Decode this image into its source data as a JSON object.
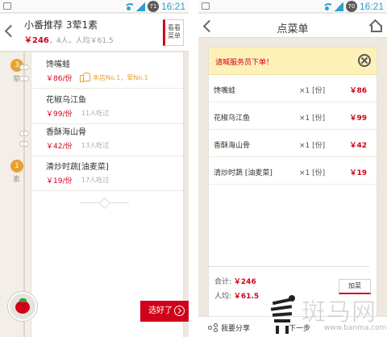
{
  "left_screen": {
    "status_bar": {
      "time": "16:21",
      "battery_level": "71"
    },
    "header": {
      "title": "小番推荐  3荤1素",
      "price": "￥246",
      "sub_rest": "，4人，人均￥61.5",
      "view_button_line1": "看看",
      "view_button_line2": "菜单"
    },
    "groups": [
      {
        "count": "3",
        "word": "荤"
      },
      {
        "count": "1",
        "word": "素"
      }
    ],
    "dishes": [
      {
        "name": "馋嘴蛙",
        "price": "￥86/份",
        "meta": "本店No.1，荤No.1"
      },
      {
        "name": "花椒乌江鱼",
        "price": "￥99/份",
        "meta": "11人吃过"
      },
      {
        "name": "香酥海山骨",
        "price": "￥42/份",
        "meta": "13人吃过"
      },
      {
        "name": "清炒时蔬[油麦菜]",
        "price": "￥19/份",
        "meta": "17人吃过"
      }
    ],
    "chosen_button": "选好了"
  },
  "right_screen": {
    "status_bar": {
      "time": "16:21",
      "battery_level": "70"
    },
    "header": {
      "title": "点菜单"
    },
    "notice": "请喊服务员下单！",
    "orders": [
      {
        "name": "馋嘴蛙",
        "qty": "×1 [份]",
        "price": "￥86"
      },
      {
        "name": "花椒乌江鱼",
        "qty": "×1 [份]",
        "price": "￥99"
      },
      {
        "name": "香酥海山骨",
        "qty": "×1 [份]",
        "price": "￥42"
      },
      {
        "name": "清炒时蔬 [油麦菜]",
        "qty": "×1 [份]",
        "price": "￥19"
      }
    ],
    "summary": {
      "total_label": "合计:",
      "total_value": "￥246",
      "avg_label": "人均:",
      "avg_value": "￥61.5",
      "add_button": "加菜"
    },
    "footer": {
      "share_label": "我要分享",
      "second_label": "下一步"
    }
  },
  "watermark": {
    "chars": "斑马网",
    "url": "www.banma.com"
  },
  "colors": {
    "accent_red": "#d0021b",
    "tag_orange": "#e8a12f",
    "notice_yellow": "#fdf1b8",
    "background": "#efe8de"
  }
}
